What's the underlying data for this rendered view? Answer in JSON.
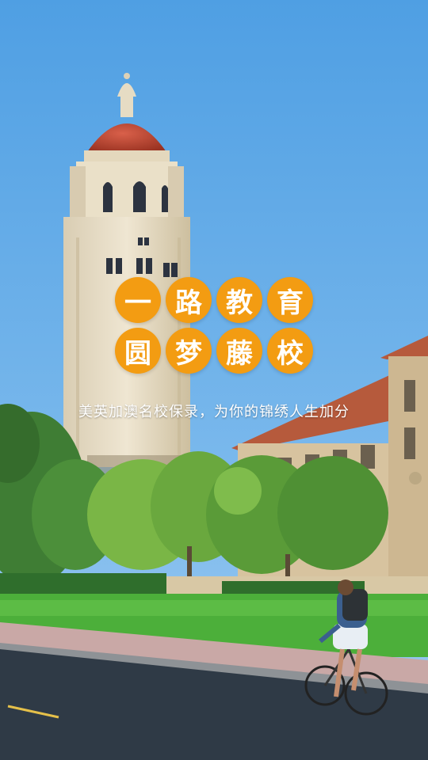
{
  "splash": {
    "headline_line1": [
      "一",
      "路",
      "教",
      "育"
    ],
    "headline_line2": [
      "圆",
      "梦",
      "藤",
      "校"
    ],
    "subtitle": "美英加澳名校保录，为你的锦绣人生加分"
  },
  "colors": {
    "accent": "#f39c12",
    "sky": "#5aa6e6",
    "text": "#ffffff"
  }
}
